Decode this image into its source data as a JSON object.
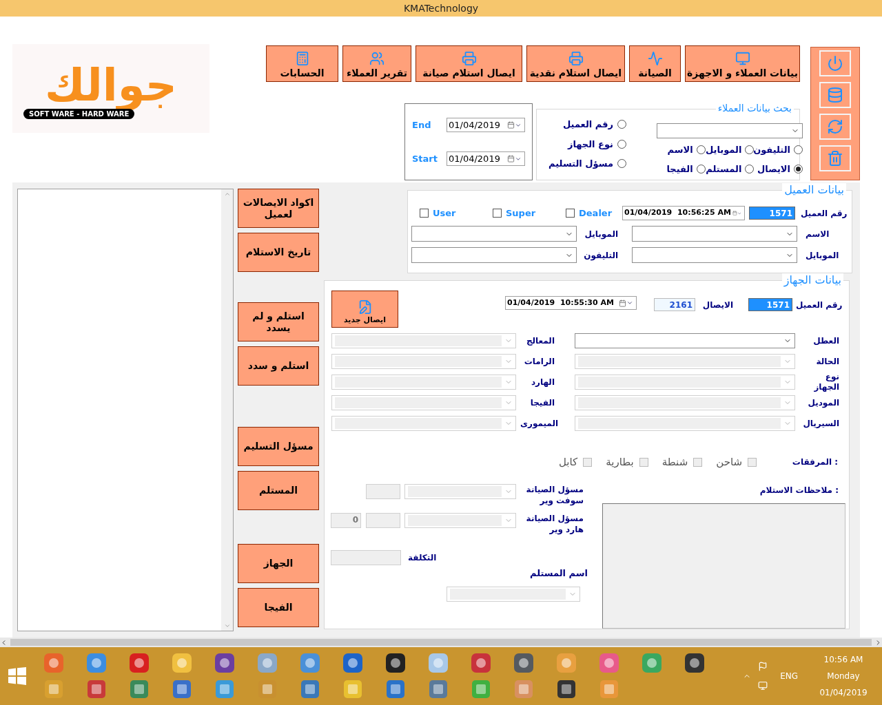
{
  "window": {
    "title": "KMATechnology"
  },
  "logo": {
    "name": "جوالك",
    "tagline": "SOFT WARE - HARD WARE"
  },
  "nav_buttons": [
    {
      "label": "بيانات العملاء و الاجهزة"
    },
    {
      "label": "الصيانة"
    },
    {
      "label": "ايصال استلام نقدية"
    },
    {
      "label": "ايصال استلام صيانة"
    },
    {
      "label": "تقرير العملاء"
    },
    {
      "label": "الحسابات"
    }
  ],
  "date_filter": {
    "end_label": "End",
    "end_value": "01/04/2019",
    "start_label": "Start",
    "start_value": "01/04/2019"
  },
  "search": {
    "title": "بحث بيانات العملاء",
    "column_options": [
      {
        "label": "رقم العميل",
        "selected": false
      },
      {
        "label": "نوع الجهاز",
        "selected": false
      },
      {
        "label": "مسؤل التسليم",
        "selected": false
      }
    ],
    "grid_options": [
      {
        "label": "التليفون",
        "selected": false
      },
      {
        "label": "الموبايل",
        "selected": false
      },
      {
        "label": "الاسم",
        "selected": false
      },
      {
        "label": "الايصال",
        "selected": true
      },
      {
        "label": "المستلم",
        "selected": false
      },
      {
        "label": "الفيجا",
        "selected": false
      }
    ]
  },
  "side_button_groups": [
    [
      "اكواد الايصالات لعميل",
      "تاريخ الاستلام"
    ],
    [
      "استلم و لم يسدد",
      "استلم و سدد"
    ],
    [
      "مسؤل التسليم",
      "المستلم"
    ],
    [
      "الجهاز",
      "الفيجا"
    ]
  ],
  "customer": {
    "title": "بيانات العميل",
    "checks": [
      {
        "label": "Dealer",
        "checked": false
      },
      {
        "label": "Super",
        "checked": false
      },
      {
        "label": "User",
        "checked": false
      }
    ],
    "datetime": "01/04/2019  10:56:25 AM",
    "number_label": "رقم العميل",
    "number": "1571",
    "right_fields": [
      {
        "label": "الاسم"
      },
      {
        "label": "الموبايل"
      }
    ],
    "left_fields": [
      {
        "label": "الموبايل"
      },
      {
        "label": "التليفون"
      }
    ]
  },
  "device": {
    "title": "بيانات الجهاز",
    "new_button": "ايصال جديد",
    "datetime": "01/04/2019  10:55:30 AM",
    "receipt_label": "الايصال",
    "receipt": "2161",
    "number_label": "رقم العميل",
    "number": "1571",
    "right_fields": [
      {
        "label": "العطل",
        "disabled": false
      },
      {
        "label": "الحالة",
        "disabled": true
      },
      {
        "label": "نوع الجهاز",
        "disabled": true
      },
      {
        "label": "الموديل",
        "disabled": true
      },
      {
        "label": "السيريال",
        "disabled": true
      }
    ],
    "left_fields": [
      {
        "label": "المعالج",
        "disabled": true
      },
      {
        "label": "الرامات",
        "disabled": true
      },
      {
        "label": "الهارد",
        "disabled": true
      },
      {
        "label": "الفيجا",
        "disabled": true
      },
      {
        "label": "الميمورى",
        "disabled": true
      }
    ],
    "attachments_label": "المرفقات :",
    "attachments": [
      {
        "label": "شاحن",
        "checked": false
      },
      {
        "label": "شنطة",
        "checked": false
      },
      {
        "label": "بطارية",
        "checked": false
      },
      {
        "label": "كابل",
        "checked": false
      }
    ],
    "software_label": "مسؤل الصيانة سوفت وير",
    "hardware_label": "مسؤل الصيانة هارد وير",
    "hardware_count": "0",
    "cost_label": "التكلفة",
    "receiver_label": "اسم المستلم",
    "notes_label": "ملاحظات الاستلام :"
  },
  "taskbar": {
    "language": "ENG",
    "time": "10:56 AM",
    "day": "Monday",
    "date": "01/04/2019"
  }
}
